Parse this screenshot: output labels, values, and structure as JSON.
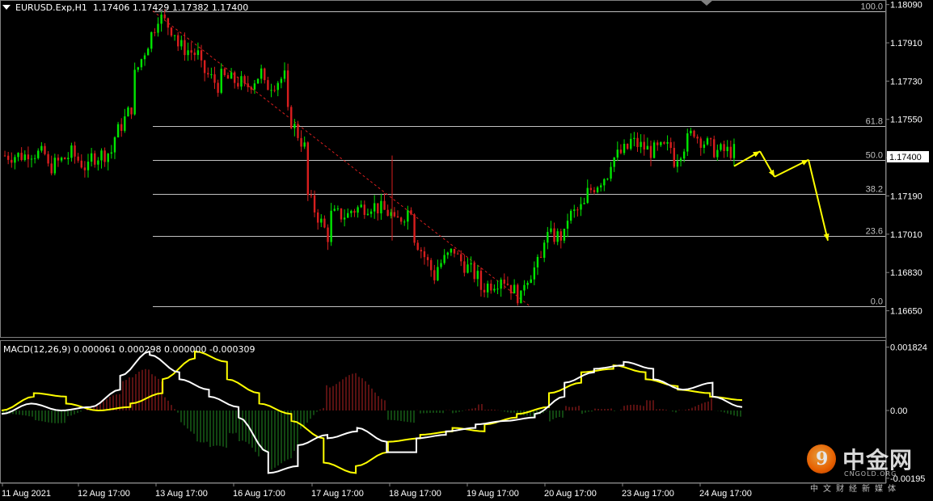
{
  "header": {
    "symbol": "EURUSD.Exp,H1",
    "ohlc": "1.17406 1.17429 1.17382 1.17400"
  },
  "price_axis": {
    "labels": [
      "1.18090",
      "1.17910",
      "1.17730",
      "1.17550",
      "1.17370",
      "1.17190",
      "1.17010",
      "1.16830",
      "1.16650"
    ],
    "current_price": "1.17400"
  },
  "fibonacci": {
    "levels": [
      {
        "label": "100.0",
        "price": 1.1806
      },
      {
        "label": "61.8",
        "price": 1.1752
      },
      {
        "label": "50.0",
        "price": 1.1736
      },
      {
        "label": "38.2",
        "price": 1.172
      },
      {
        "label": "23.6",
        "price": 1.17
      },
      {
        "label": "0.0",
        "price": 1.1667
      }
    ]
  },
  "macd": {
    "header": "MACD(12,26,9) 0.000061 0.000298 0.000000 -0.000309",
    "axis_labels": [
      "0.001824",
      "0.00",
      "-0.00195"
    ]
  },
  "time_axis": {
    "labels": [
      "11 Aug 2021",
      "12 Aug 17:00",
      "13 Aug 17:00",
      "16 Aug 17:00",
      "17 Aug 17:00",
      "18 Aug 17:00",
      "19 Aug 17:00",
      "20 Aug 17:00",
      "23 Aug 17:00",
      "24 Aug 17:00"
    ]
  },
  "watermark": {
    "logo_char": "9",
    "name": "中金网",
    "site": "CNGOLD.ORG",
    "tagline": "中文财经新媒体"
  },
  "colors": {
    "bull": "#00e600",
    "bear": "#d81e1e",
    "macd_main": "#ffffff",
    "macd_signal": "#ffff00",
    "hist_pos": "#b22222",
    "hist_neg": "#228b22",
    "arrows": "#ffff00",
    "grid": "#c0c0c0"
  },
  "chart_data": {
    "type": "candlestick",
    "symbol": "EURUSD",
    "timeframe": "H1",
    "ylim": [
      1.1658,
      1.181
    ],
    "anchors": [
      [
        1.1738,
        1.1738
      ],
      [
        1.174,
        1.1738
      ],
      [
        1.1732,
        1.1738
      ],
      [
        1.174,
        1.173
      ],
      [
        1.1737,
        1.174
      ],
      [
        1.1745,
        1.1763
      ],
      [
        1.1775,
        1.18
      ],
      [
        1.1805,
        1.1795
      ],
      [
        1.179,
        1.1785
      ],
      [
        1.178,
        1.177
      ],
      [
        1.1775,
        1.1772
      ],
      [
        1.1768,
        1.1778
      ],
      [
        1.177,
        1.1775
      ],
      [
        1.176,
        1.174
      ],
      [
        1.172,
        1.17
      ],
      [
        1.171,
        1.171
      ],
      [
        1.1712,
        1.1715
      ],
      [
        1.1715,
        1.171
      ],
      [
        1.1705,
        1.1715
      ],
      [
        1.17,
        1.168
      ],
      [
        1.1685,
        1.1695
      ],
      [
        1.169,
        1.168
      ],
      [
        1.1675,
        1.168
      ],
      [
        1.1682,
        1.167
      ],
      [
        1.1678,
        1.169
      ],
      [
        1.17,
        1.17
      ],
      [
        1.1708,
        1.1715
      ],
      [
        1.172,
        1.173
      ],
      [
        1.1735,
        1.1742
      ],
      [
        1.1745,
        1.174
      ],
      [
        1.174,
        1.1742
      ],
      [
        1.1735,
        1.175
      ],
      [
        1.1748,
        1.174
      ],
      [
        1.174,
        1.174
      ]
    ],
    "macd_main_path": [
      [
        -0.0001,
        0.0002
      ],
      [
        0.0002,
        0.0
      ],
      [
        0.0,
        0.0001
      ],
      [
        0.0001,
        0.0006
      ],
      [
        0.001,
        0.0017
      ],
      [
        0.0016,
        0.0011
      ],
      [
        0.0009,
        0.0006
      ],
      [
        0.0004,
        0.0001
      ],
      [
        -0.0002,
        -0.0012
      ],
      [
        -0.0018,
        -0.0016
      ],
      [
        -0.001,
        -0.0007
      ],
      [
        -0.0008,
        -0.0006
      ],
      [
        -0.0005,
        -0.0009
      ],
      [
        -0.0012,
        -0.0012
      ],
      [
        -0.0008,
        -0.0007
      ],
      [
        -0.0006,
        -0.0005
      ],
      [
        -0.0004,
        -0.0003
      ],
      [
        -0.0003,
        -0.0002
      ],
      [
        -0.0001,
        0.0004
      ],
      [
        0.0008,
        0.0011
      ],
      [
        0.0012,
        0.0013
      ],
      [
        0.0014,
        0.0012
      ],
      [
        0.0009,
        0.0006
      ],
      [
        0.0006,
        0.0008
      ],
      [
        0.0004,
        0.0001
      ]
    ],
    "macd_signal_path": [
      [
        0.0,
        0.0004
      ],
      [
        0.0005,
        0.0004
      ],
      [
        0.0002,
        0.0
      ],
      [
        0.0,
        0.0001
      ],
      [
        0.0002,
        0.0005
      ],
      [
        0.0009,
        0.0015
      ],
      [
        0.0017,
        0.0014
      ],
      [
        0.0009,
        0.0005
      ],
      [
        0.0002,
        -0.0001
      ],
      [
        -0.0003,
        -0.0008
      ],
      [
        -0.0015,
        -0.0018
      ],
      [
        -0.0016,
        -0.0012
      ],
      [
        -0.0009,
        -0.0008
      ],
      [
        -0.0007,
        -0.0006
      ],
      [
        -0.0005,
        -0.0006
      ],
      [
        -0.0004,
        -0.0002
      ],
      [
        -0.0001,
        0.0001
      ],
      [
        0.0005,
        0.0008
      ],
      [
        0.0011,
        0.0012
      ],
      [
        0.0013,
        0.0011
      ],
      [
        0.0009,
        0.0007
      ],
      [
        0.0006,
        0.0005
      ],
      [
        0.0004,
        0.0003
      ]
    ],
    "forecast_arrows": [
      [
        [
          1.1733,
          1.1737
        ],
        [
          1.1737,
          1.174
        ]
      ],
      [
        [
          1.174,
          1.1738
        ],
        [
          1.1738,
          1.1728
        ]
      ],
      [
        [
          1.1728,
          1.1733
        ],
        [
          1.1733,
          1.1736
        ]
      ],
      [
        [
          1.1736,
          1.1718
        ],
        [
          1.1718,
          1.1698
        ]
      ]
    ]
  }
}
